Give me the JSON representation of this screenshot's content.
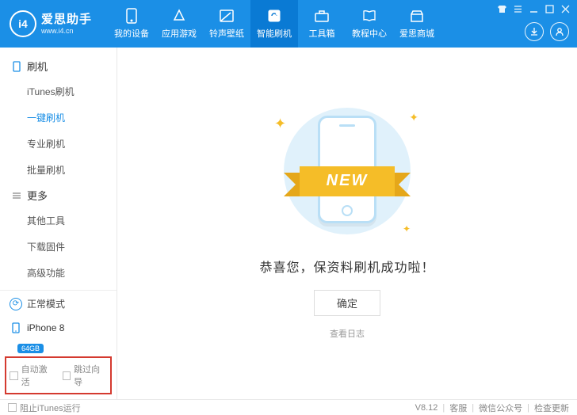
{
  "brand": {
    "name": "爱思助手",
    "url": "www.i4.cn",
    "logo_text": "i4"
  },
  "nav": [
    {
      "label": "我的设备"
    },
    {
      "label": "应用游戏"
    },
    {
      "label": "铃声壁纸"
    },
    {
      "label": "智能刷机"
    },
    {
      "label": "工具箱"
    },
    {
      "label": "教程中心"
    },
    {
      "label": "爱思商城"
    }
  ],
  "sidebar": {
    "group1": {
      "title": "刷机",
      "items": [
        "iTunes刷机",
        "一键刷机",
        "专业刷机",
        "批量刷机"
      ],
      "active_index": 1
    },
    "group2": {
      "title": "更多",
      "items": [
        "其他工具",
        "下载固件",
        "高级功能"
      ]
    },
    "mode": "正常模式",
    "device": {
      "name": "iPhone 8",
      "storage": "64GB"
    },
    "checks": {
      "auto_activate": "自动激活",
      "skip_guide": "跳过向导"
    }
  },
  "main": {
    "ribbon": "NEW",
    "message": "恭喜您，保资料刷机成功啦！",
    "ok": "确定",
    "log": "查看日志"
  },
  "footer": {
    "block_itunes": "阻止iTunes运行",
    "version": "V8.12",
    "links": [
      "客服",
      "微信公众号",
      "检查更新"
    ]
  }
}
